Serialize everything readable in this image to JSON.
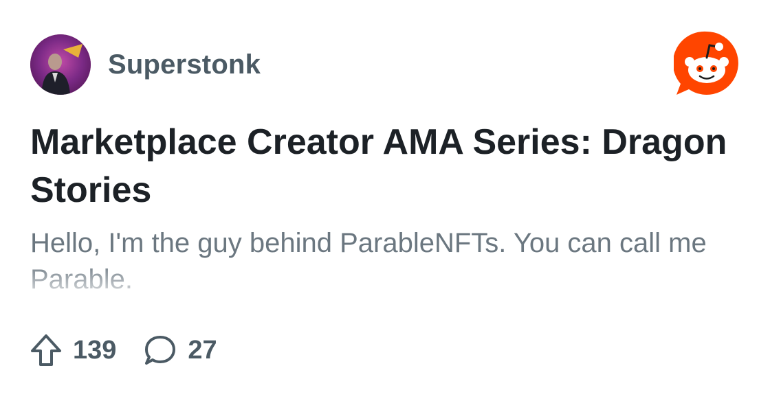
{
  "community": {
    "name": "Superstonk",
    "avatar_icon": "community-avatar-icon"
  },
  "post": {
    "title": "Marketplace Creator AMA Series: Dragon Stories",
    "body": "Hello, I'm the guy behind ParableNFTs. You can call me Parable."
  },
  "stats": {
    "upvotes": "139",
    "comments": "27",
    "upvote_icon": "upvote-arrow-icon",
    "comment_icon": "comment-bubble-icon"
  },
  "brand": {
    "logo_icon": "reddit-snoo-icon",
    "accent": "#ff4500"
  }
}
